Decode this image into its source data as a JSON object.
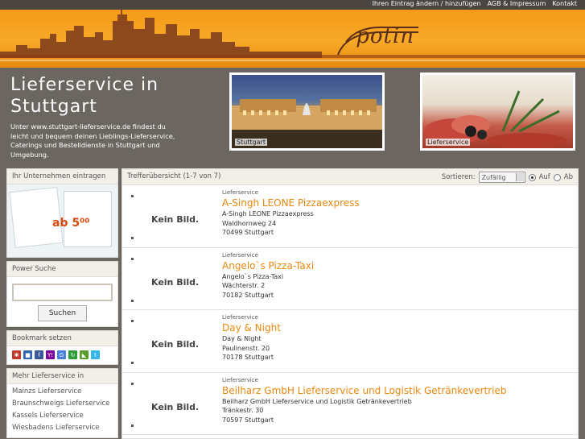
{
  "topnav": {
    "links": [
      "Ihren Eintrag ändern / hinzufügen",
      "AGB & Impressum",
      "Kontakt"
    ]
  },
  "banner": {
    "logo": "potin"
  },
  "header": {
    "title_line1": "Lieferservice in",
    "title_line2": "Stuttgart",
    "description": "Unter www.stuttgart-lieferservice.de findest du leicht und bequem deinen Lieblings-Lieferservice, Caterings und Bestelldienste in Stuttgart und Umgebung.",
    "photos": [
      {
        "caption": "Stuttgart"
      },
      {
        "caption": "Lieferservice"
      }
    ]
  },
  "sidebar": {
    "register": {
      "heading": "Ihr Unternehmen eintragen",
      "promo_price": "ab 5⁰⁰"
    },
    "search": {
      "heading": "Power Suche",
      "button": "Suchen"
    },
    "bookmark": {
      "heading": "Bookmark setzen",
      "icons": [
        {
          "name": "misterwong-icon",
          "color": "#c0392b",
          "glyph": "✱"
        },
        {
          "name": "delicious-icon",
          "color": "#3465b0",
          "glyph": "■"
        },
        {
          "name": "facebook-icon",
          "color": "#3b5998",
          "glyph": "f"
        },
        {
          "name": "yahoo-icon",
          "color": "#7b0099",
          "glyph": "Y!"
        },
        {
          "name": "google-icon",
          "color": "#4a7fe0",
          "glyph": "G"
        },
        {
          "name": "linkarena-icon",
          "color": "#2f9b3a",
          "glyph": "↻"
        },
        {
          "name": "webnews-icon",
          "color": "#5a9c2e",
          "glyph": "◣"
        },
        {
          "name": "twitter-icon",
          "color": "#33b5e5",
          "glyph": "t"
        }
      ]
    },
    "more": {
      "heading": "Mehr Lieferservice in",
      "items": [
        "Mainzs Lieferservice",
        "Braunschweigs Lieferservice",
        "Kassels Lieferservice",
        "Wiesbadens Lieferservice"
      ]
    }
  },
  "main": {
    "count": "Trefferübersicht (1-7 von 7)",
    "sort_label": "Sortieren:",
    "sort_value": "Zufällig",
    "asc": "Auf",
    "desc": "Ab",
    "no_image": "Kein Bild.",
    "listings": [
      {
        "category": "Lieferservice",
        "name": "A-Singh LEONE Pizzaexpress",
        "line1": "A-Singh LEONE Pizzaexpress",
        "street": "Waldhornweg 24",
        "city": "70499 Stuttgart"
      },
      {
        "category": "Lieferservice",
        "name": "Angelo`s Pizza-Taxi",
        "line1": "Angelo`s Pizza-Taxi",
        "street": "Wächterstr. 2",
        "city": "70182 Stuttgart"
      },
      {
        "category": "Lieferservice",
        "name": "Day & Night",
        "line1": "Day & Night",
        "street": "Paulinenstr. 20",
        "city": "70178 Stuttgart"
      },
      {
        "category": "Lieferservice",
        "name": "Beilharz GmbH Lieferservice und Logistik Getränkevertrieb",
        "line1": "Beilharz GmbH Lieferservice und Logistik Getränkevertrieb",
        "street": "Tränkestr. 30",
        "city": "70597 Stuttgart"
      }
    ]
  }
}
